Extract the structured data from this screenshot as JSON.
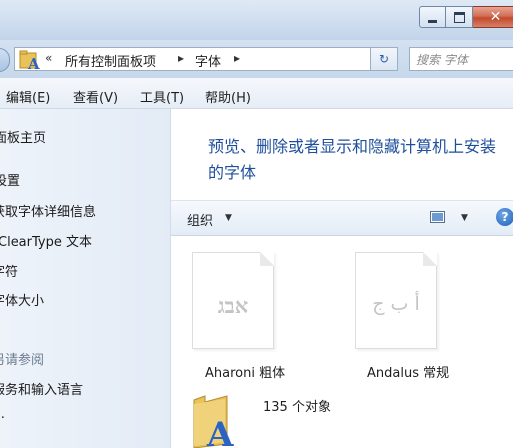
{
  "address": {
    "crumb_prefix": "«",
    "crumbs": [
      "所有控制面板项",
      "字体"
    ],
    "search_placeholder": "搜索 字体"
  },
  "menu": [
    "编辑(E)",
    "查看(V)",
    "工具(T)",
    "帮助(H)"
  ],
  "left_panel": {
    "links": [
      "面板主页",
      "设置",
      "获取字体详细信息",
      "ClearType 文本",
      "字符",
      "字体大小"
    ],
    "see_also_heading": "另请参阅",
    "see_also_links": [
      "服务和输入语言",
      "…"
    ]
  },
  "content": {
    "heading": "预览、删除或者显示和隐藏计算机上安装的字体",
    "toolbar_organize": "组织",
    "fonts": [
      {
        "name": "Aharoni 粗体",
        "sample": "אבג"
      },
      {
        "name": "Andalus 常规",
        "sample": "أ ب ج"
      }
    ],
    "status_count": "135 个对象"
  },
  "colors": {
    "heading_blue": "#1e4f9c",
    "close_red": "#c24a2c",
    "panel_bg": "#e8eef7"
  }
}
